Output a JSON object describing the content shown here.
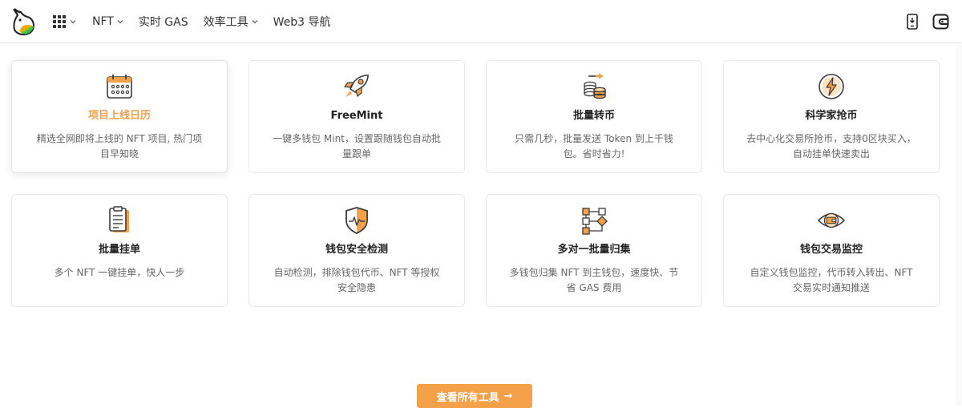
{
  "header": {
    "nav": [
      {
        "label": "NFT",
        "has_menu": true
      },
      {
        "label": "实时 GAS",
        "has_menu": false
      },
      {
        "label": "效率工具",
        "has_menu": true
      },
      {
        "label": "Web3 导航",
        "has_menu": false
      }
    ],
    "right_icons": [
      "phone-download-icon",
      "wallet-icon"
    ]
  },
  "tools": [
    {
      "title": "项目上线日历",
      "desc": "精选全网即将上线的 NFT 项目, 热门项目早知晓",
      "icon": "calendar-icon",
      "active": true
    },
    {
      "title": "FreeMint",
      "desc": "一键多钱包 Mint，设置跟随钱包自动批量跟单",
      "icon": "rocket-icon",
      "active": false
    },
    {
      "title": "批量转币",
      "desc": "只需几秒，批量发送 Token 到上千钱包。省时省力!",
      "icon": "coins-transfer-icon",
      "active": false
    },
    {
      "title": "科学家抢币",
      "desc": "去中心化交易所抢币，支持0区块买入，自动挂单快速卖出",
      "icon": "lightning-icon",
      "active": false
    },
    {
      "title": "批量挂单",
      "desc": "多个 NFT 一键挂单，快人一步",
      "icon": "clipboard-icon",
      "active": false
    },
    {
      "title": "钱包安全检测",
      "desc": "自动检测，排除钱包代币、NFT 等授权安全隐患",
      "icon": "shield-icon",
      "active": false
    },
    {
      "title": "多对一批量归集",
      "desc": "多钱包归集 NFT 到主钱包，速度快、节省 GAS 费用",
      "icon": "flow-icon",
      "active": false
    },
    {
      "title": "钱包交易监控",
      "desc": "自定义钱包监控，代币转入转出、NFT 交易实时通知推送",
      "icon": "eye-wallet-icon",
      "active": false
    }
  ],
  "all_tools_button": {
    "label": "查看所有工具",
    "arrow": "→"
  },
  "colors": {
    "accent": "#f4a14a",
    "icon_dark": "#3a3a3a"
  }
}
